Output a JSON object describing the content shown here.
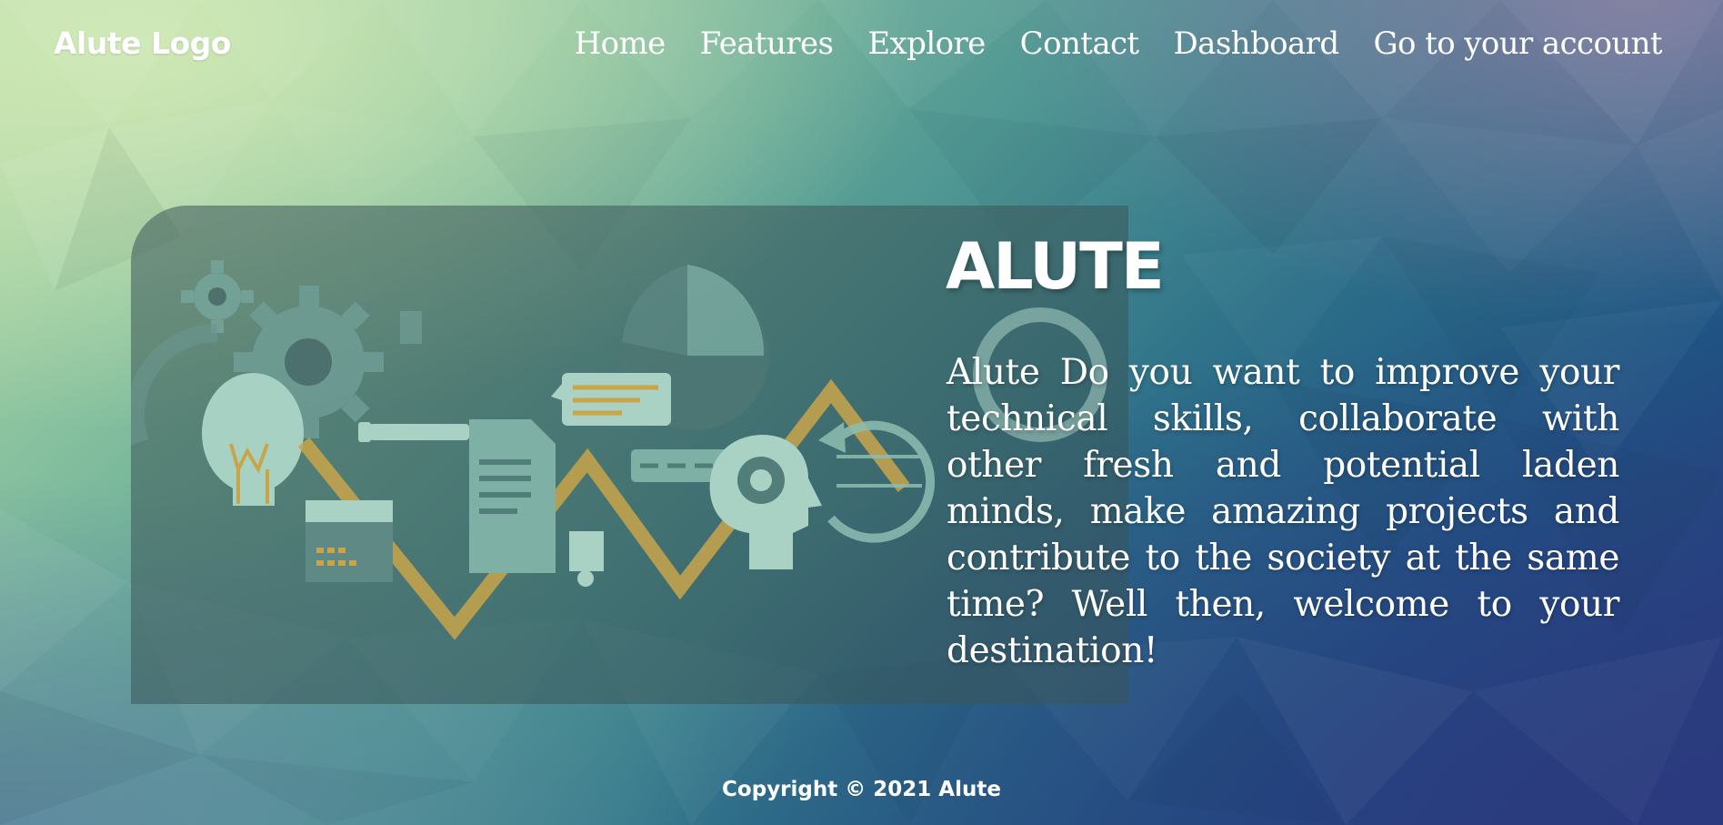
{
  "header": {
    "logo_text": "Alute Logo",
    "nav": [
      {
        "label": "Home"
      },
      {
        "label": "Features"
      },
      {
        "label": "Explore"
      },
      {
        "label": "Contact"
      },
      {
        "label": "Dashboard"
      },
      {
        "label": "Go to your account"
      }
    ]
  },
  "hero": {
    "title": "ALUTE",
    "description": "Alute Do you want to improve your technical skills, collaborate with other fresh and potential laden minds, make amazing projects and contribute to the society at the same time? Well then, welcome to your destination!",
    "illustration_icons": [
      "gear-icon",
      "lightbulb-icon",
      "pen-icon",
      "document-icon",
      "chat-bubble-icon",
      "pie-chart-icon",
      "calendar-icon",
      "puzzle-icon",
      "head-gear-icon",
      "refresh-arrows-icon"
    ]
  },
  "footer": {
    "copyright": "Copyright © 2021 Alute"
  },
  "colors": {
    "accent_gold": "#c9a54a",
    "panel_bg": "#3a5658",
    "text": "#ffffff",
    "bg_top_left": "#cfe8b4",
    "bg_bottom_right": "#2a3a7d"
  }
}
